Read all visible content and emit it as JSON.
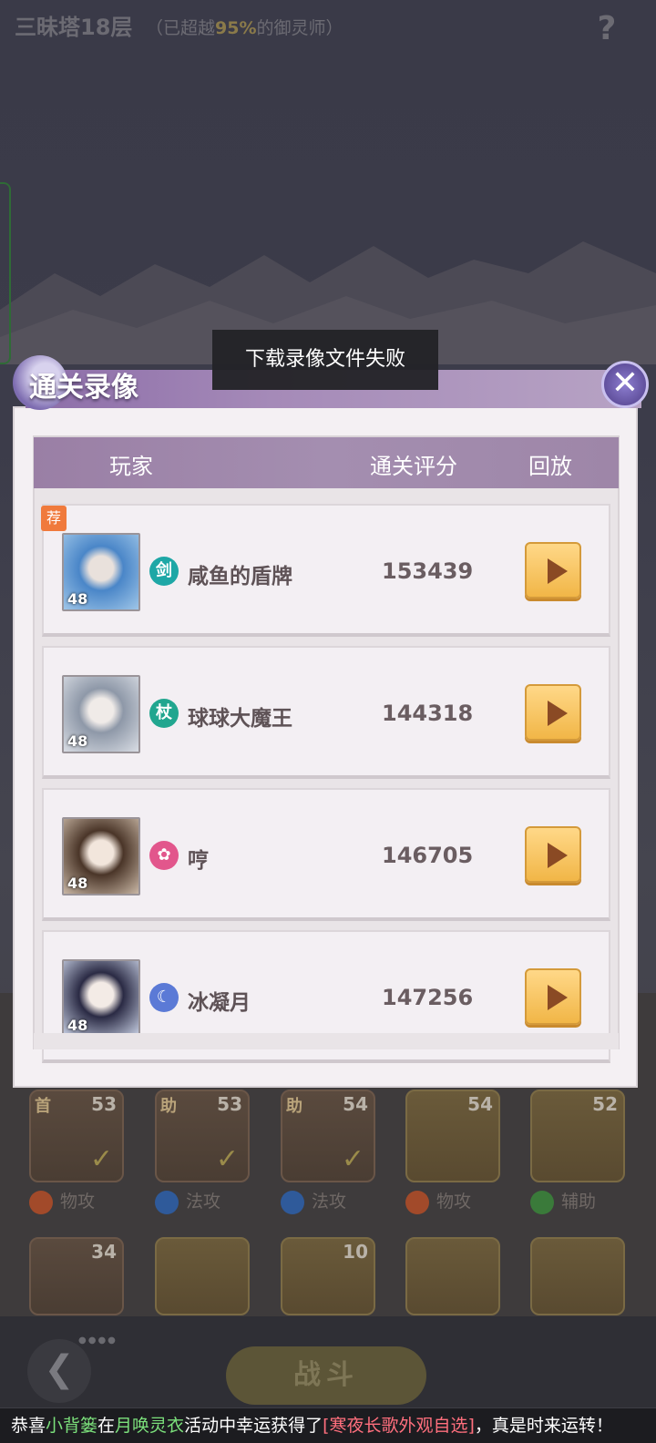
{
  "top_bar": {
    "floor_title": "三昧塔18层",
    "floor_sub_prefix": "（已超越",
    "floor_sub_pct": "95%",
    "floor_sub_suffix": "的御灵师）",
    "help_icon": "question-mark-icon",
    "help_glyph": "?"
  },
  "toast": {
    "message": "下载录像文件失败"
  },
  "modal": {
    "title": "通关录像",
    "close_icon": "close-icon",
    "close_glyph": "✕",
    "headers": {
      "player": "玩家",
      "score": "通关评分",
      "replay": "回放"
    },
    "recommend_badge": "荐",
    "rows": [
      {
        "level": "48",
        "sect_icon": "sword-sect-icon",
        "sect_glyph": "剑",
        "sect_color": "#1ea7a6",
        "name": "咸鱼的盾牌",
        "score": "153439"
      },
      {
        "level": "48",
        "sect_icon": "staff-sect-icon",
        "sect_glyph": "杖",
        "sect_color": "#21a68f",
        "name": "球球大魔王",
        "score": "144318"
      },
      {
        "level": "48",
        "sect_icon": "flower-sect-icon",
        "sect_glyph": "✿",
        "sect_color": "#e2568c",
        "name": "哼",
        "score": "146705"
      },
      {
        "level": "48",
        "sect_icon": "moon-sect-icon",
        "sect_glyph": "☾",
        "sect_color": "#5b7ad6",
        "name": "冰凝月",
        "score": "147256"
      }
    ]
  },
  "roster": {
    "row1": [
      {
        "tag": "首",
        "level": "53",
        "role": "物攻"
      },
      {
        "tag": "助",
        "level": "53",
        "role": "法攻"
      },
      {
        "tag": "助",
        "level": "54",
        "role": "法攻"
      },
      {
        "tag": "",
        "level": "54",
        "role": "物攻"
      },
      {
        "tag": "",
        "level": "52",
        "role": "辅助"
      }
    ],
    "row2": [
      {
        "level": "34"
      },
      {
        "level": ""
      },
      {
        "level": "10"
      },
      {
        "level": ""
      },
      {
        "level": ""
      }
    ]
  },
  "bottom": {
    "back_icon": "back-arrow-icon",
    "back_glyph": "❮",
    "fight_label": "战斗"
  },
  "ticker": {
    "part1": "恭喜",
    "user": "小背篓",
    "part2": "在",
    "event": "月唤灵衣",
    "part3": "活动中幸运获得了",
    "item": "[寒夜长歌外观自选]",
    "part4": "，真是时来运转！"
  },
  "colors": {
    "header_purple": "#9a7fa5",
    "play_gold": "#f1b647",
    "badge_orange": "#f07a3c"
  }
}
